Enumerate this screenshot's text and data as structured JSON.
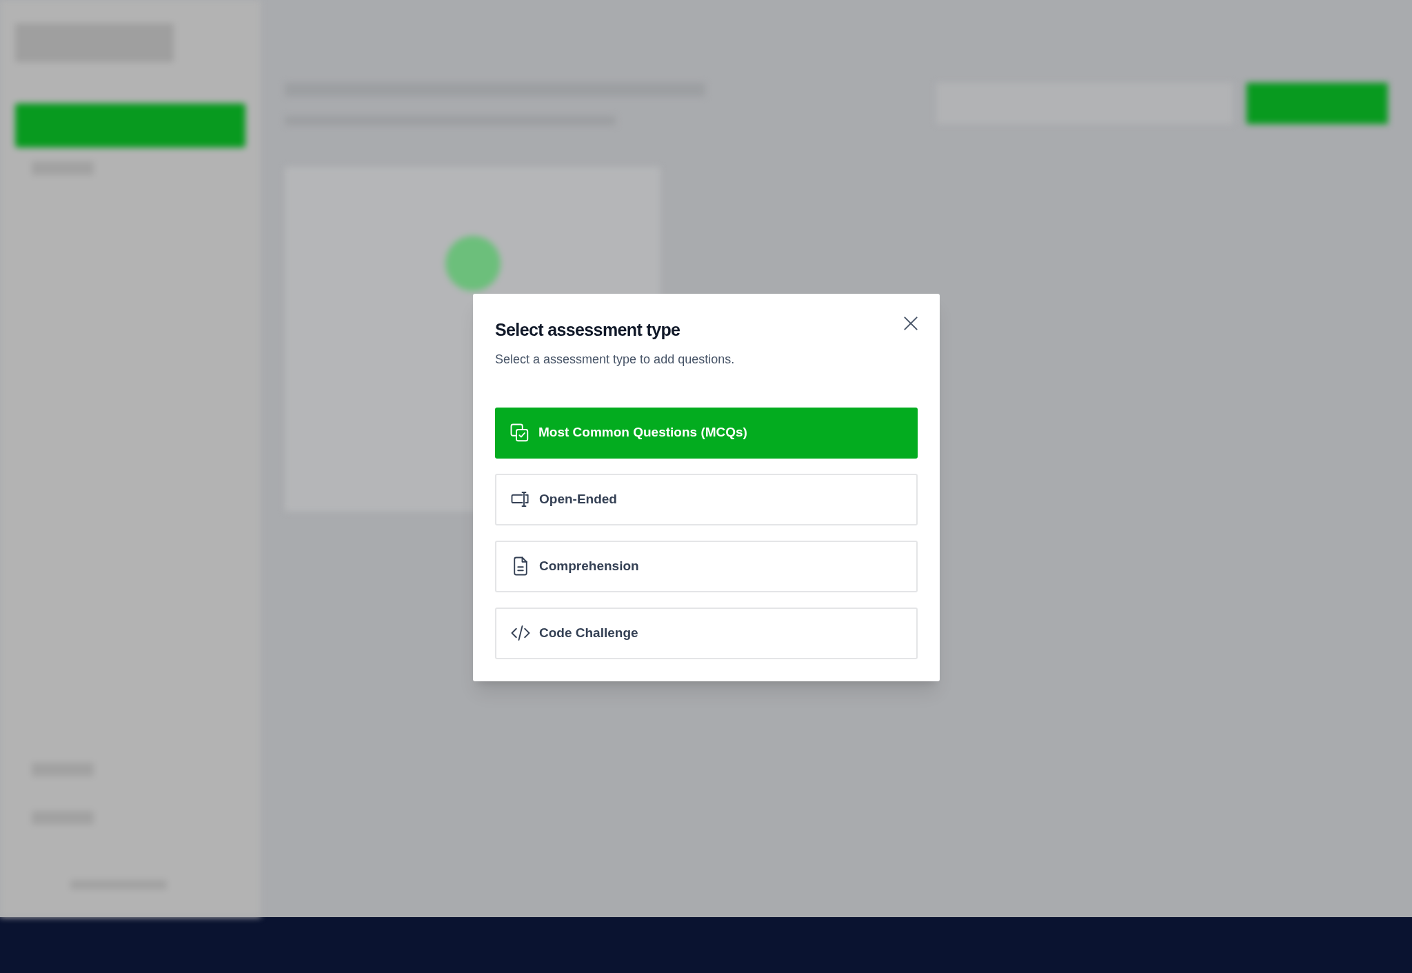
{
  "dialog": {
    "title": "Select assessment type",
    "subtitle": "Select a assessment type to add questions.",
    "options": [
      {
        "kind": "mcq",
        "label": "Most Common Questions (MCQs)",
        "selected": true
      },
      {
        "kind": "open",
        "label": "Open-Ended",
        "selected": false
      },
      {
        "kind": "document",
        "label": "Comprehension",
        "selected": false
      },
      {
        "kind": "code",
        "label": "Code Challenge",
        "selected": false
      }
    ]
  }
}
